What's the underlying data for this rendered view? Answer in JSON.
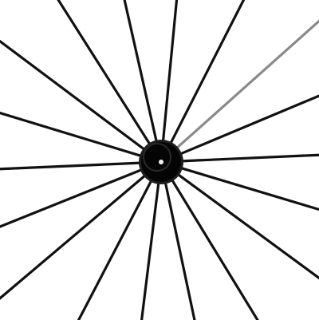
{
  "image": {
    "subject": "spoked-wheel-hub",
    "background_color": "#ffffff",
    "spoke_color": "#111111",
    "spoke_highlight_color": "#8a8a8a",
    "hub_color": "#050505",
    "hub_rim_color": "#1e1e1e",
    "axle_hole_color": "#f2f2f2",
    "spoke_count": 18
  }
}
